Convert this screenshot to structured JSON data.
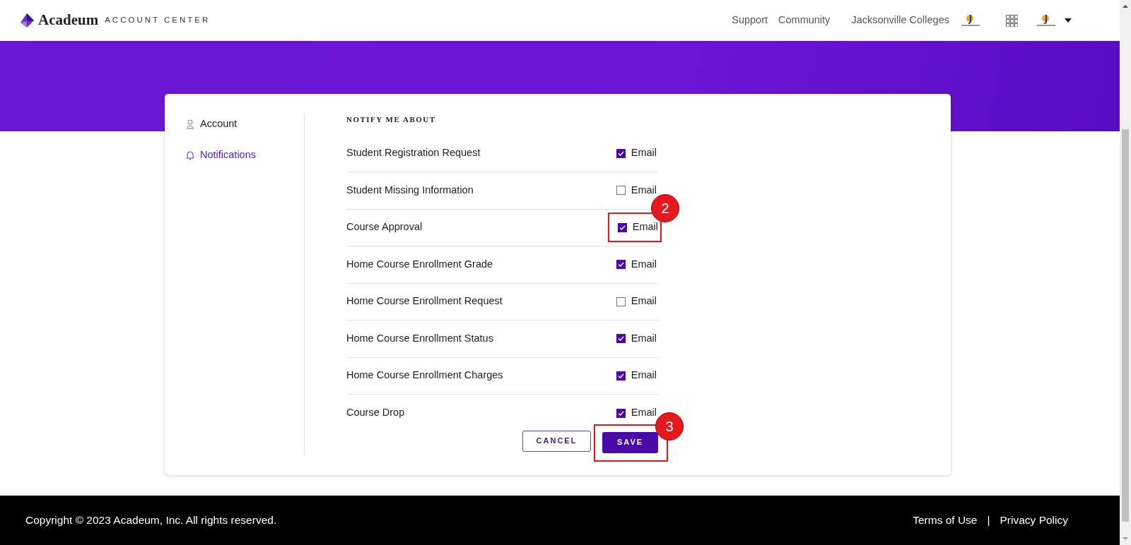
{
  "header": {
    "logo_word": "Acadeum",
    "logo_sub": "ACCOUNT CENTER",
    "links": [
      "Support",
      "Community"
    ],
    "institution": "Jacksonville Colleges"
  },
  "sidebar": {
    "items": [
      {
        "label": "Account",
        "selected": false
      },
      {
        "label": "Notifications",
        "selected": true
      }
    ]
  },
  "section_title": "NOTIFY ME ABOUT",
  "rows": [
    {
      "label": "Student Registration Request",
      "option": "Email",
      "checked": true
    },
    {
      "label": "Student Missing Information",
      "option": "Email",
      "checked": false
    },
    {
      "label": "Course Approval",
      "option": "Email",
      "checked": true,
      "annotation": "2"
    },
    {
      "label": "Home Course Enrollment Grade",
      "option": "Email",
      "checked": true
    },
    {
      "label": "Home Course Enrollment Request",
      "option": "Email",
      "checked": false
    },
    {
      "label": "Home Course Enrollment Status",
      "option": "Email",
      "checked": true
    },
    {
      "label": "Home Course Enrollment Charges",
      "option": "Email",
      "checked": true
    },
    {
      "label": "Course Drop",
      "option": "Email",
      "checked": true
    }
  ],
  "buttons": {
    "cancel": "CANCEL",
    "save": "SAVE",
    "save_annotation": "3"
  },
  "footer": {
    "copyright": "Copyright © 2023 Acadeum, Inc. All rights reserved.",
    "links": [
      "Terms of Use",
      "Privacy Policy"
    ],
    "separator": "|"
  }
}
